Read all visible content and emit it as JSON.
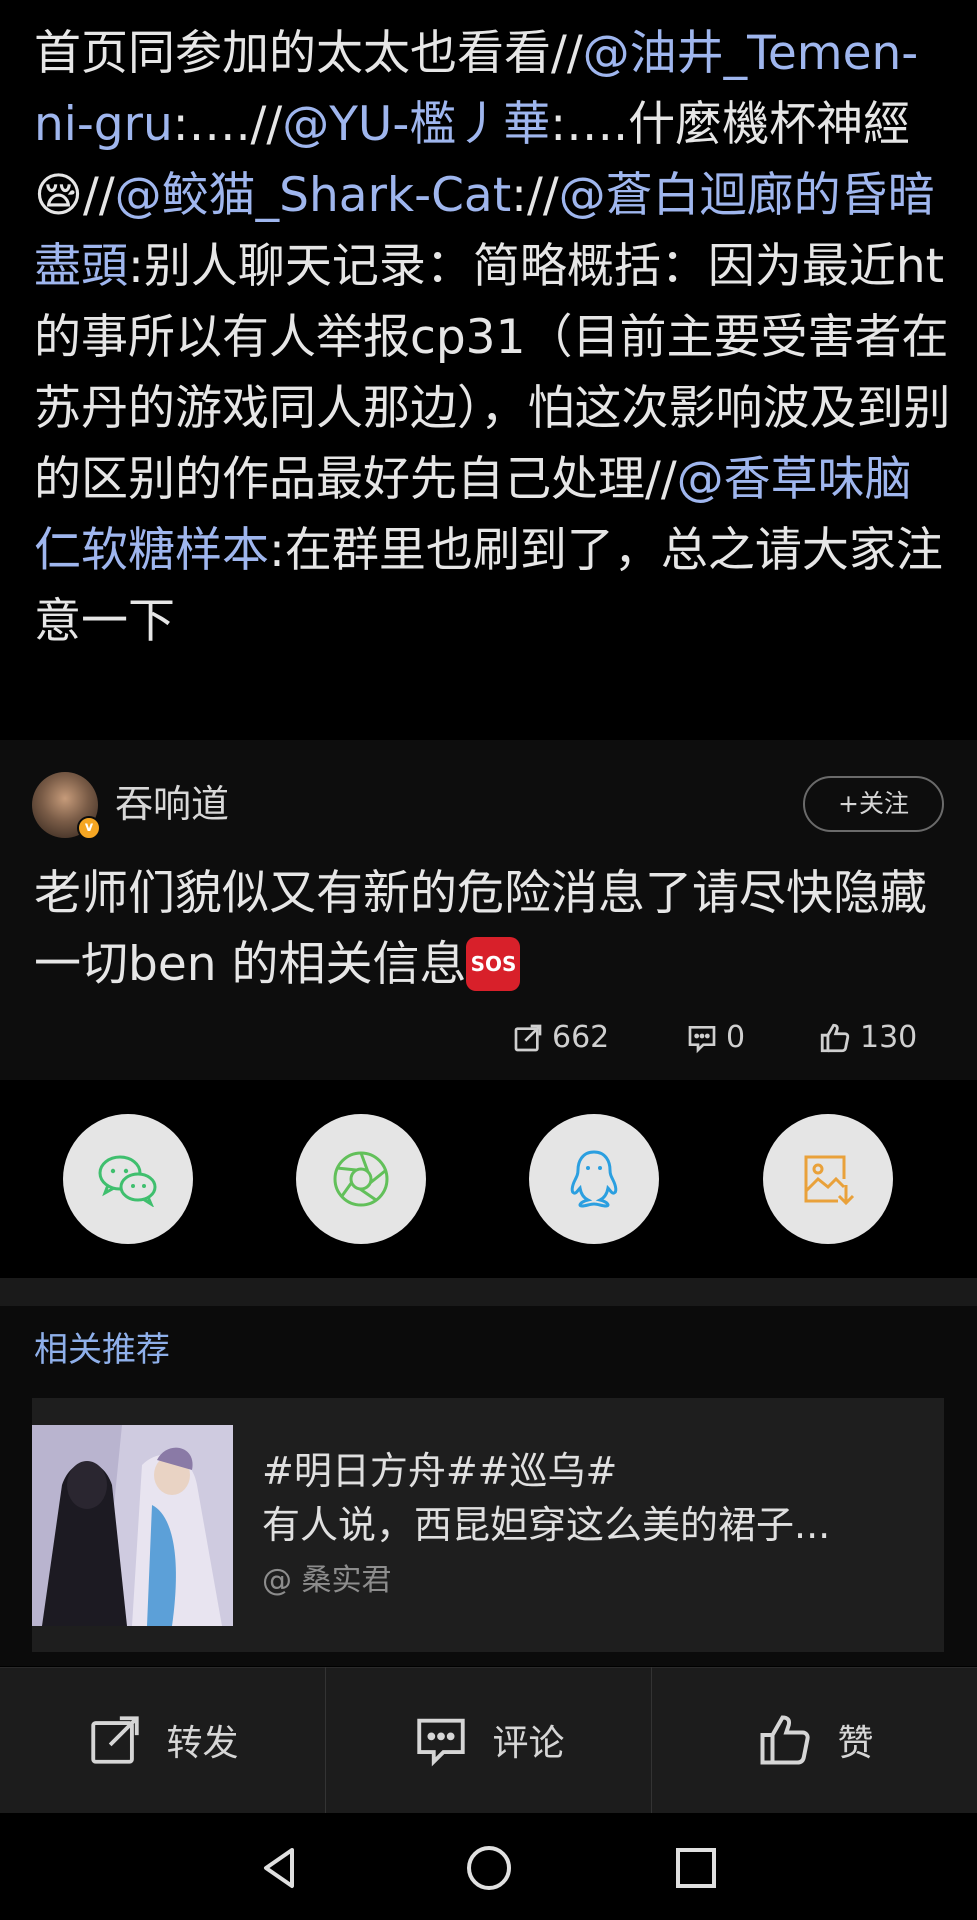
{
  "repost": {
    "segments": [
      {
        "text": "首页同参加的太太也看看//",
        "mention": false
      },
      {
        "text": "@油井_Temen-ni-gru",
        "mention": true
      },
      {
        "text": ":….//",
        "mention": false
      },
      {
        "text": "@YU-檻丿華",
        "mention": true
      },
      {
        "text": ":….什麼機杯神經😪//",
        "mention": false
      },
      {
        "text": "@鲛猫_Shark-Cat",
        "mention": true
      },
      {
        "text": ":",
        "mention": false
      },
      {
        "text": "//",
        "mention": false
      },
      {
        "text": "@蒼白迴廊的昏暗盡頭",
        "mention": true
      },
      {
        "text": ":别人聊天记录：简略概括：因为最近ht的事所以有人举报cp31（目前主要受害者在苏丹的游戏同人那边），怕这次影响波及到别的区别的作品最好先自己处理//",
        "mention": false
      },
      {
        "text": "@香草味脑仁软糖样本",
        "mention": true
      },
      {
        "text": ":在群里也刷到了，总之请大家注意一下",
        "mention": false
      }
    ]
  },
  "post": {
    "username": "吞响道",
    "verified_mark": "v",
    "follow_label": "+关注",
    "text": "老师们貌似又有新的危险消息了请尽快隐藏一切ben 的相关信息",
    "sos_label": "SOS",
    "reposts": "662",
    "comments": "0",
    "likes": "130"
  },
  "share": {
    "icons": [
      "wechat-icon",
      "moments-icon",
      "qq-icon",
      "save-image-icon"
    ],
    "colors": {
      "wechat": "#3fbf6e",
      "moments": "#62c05a",
      "qq": "#2b9fe0",
      "save": "#e9a13a"
    }
  },
  "related": {
    "title": "相关推荐",
    "line1": "#明日方舟##巡乌#",
    "line2": "有人说，西昆妲穿这么美的裙子...",
    "author": "@ 桑实君"
  },
  "actions": {
    "repost_label": "转发",
    "comment_label": "评论",
    "like_label": "赞"
  },
  "colors": {
    "mention": "#9fb6ee",
    "related_title": "#8fb0ea",
    "background": "#000000"
  }
}
